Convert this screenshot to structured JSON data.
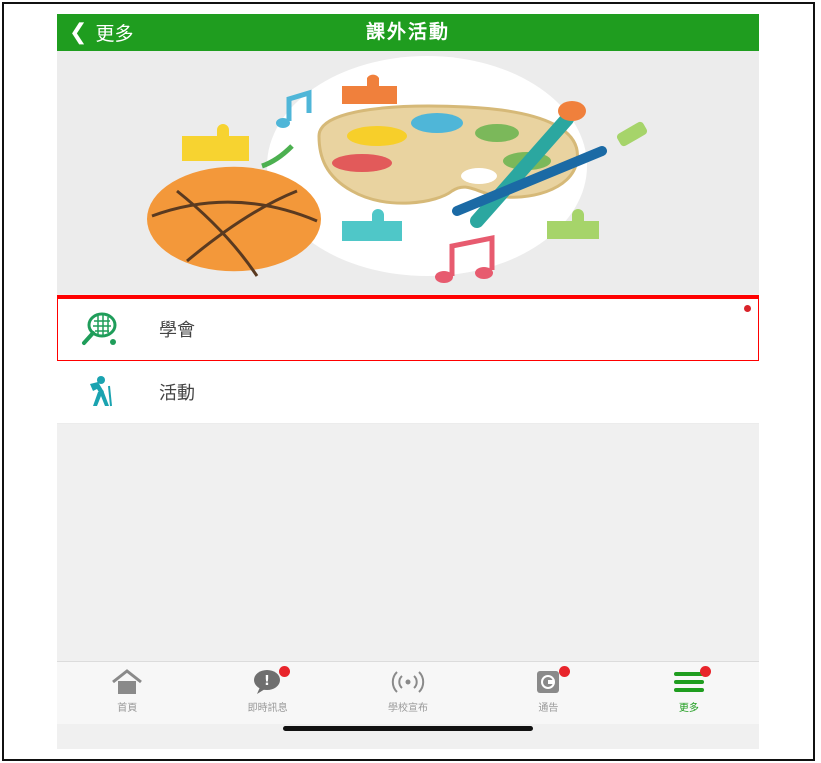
{
  "header": {
    "back_label": "更多",
    "title": "課外活動"
  },
  "list": {
    "items": [
      {
        "label": "學會",
        "icon": "tennis-racket-icon",
        "has_dot": true
      },
      {
        "label": "活動",
        "icon": "hiking-person-icon",
        "has_dot": false
      }
    ]
  },
  "tabbar": {
    "tabs": [
      {
        "label": "首頁",
        "icon": "home-icon",
        "badge": false
      },
      {
        "label": "即時訊息",
        "icon": "chat-bubble-icon",
        "badge": true
      },
      {
        "label": "學校宣布",
        "icon": "broadcast-icon",
        "badge": false
      },
      {
        "label": "通告",
        "icon": "notice-icon",
        "badge": true
      },
      {
        "label": "更多",
        "icon": "menu-icon",
        "badge": true
      }
    ],
    "active_index": 4
  },
  "colors": {
    "brand_green": "#1f9d1f",
    "highlight_red": "#ff0000",
    "badge_red": "#e8242b"
  }
}
